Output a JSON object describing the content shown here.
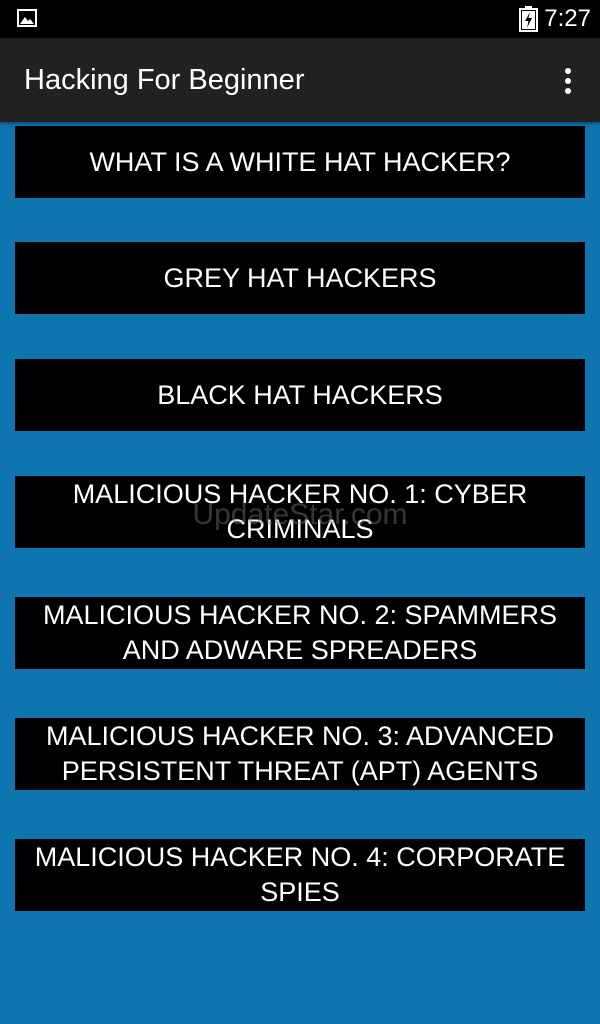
{
  "status_bar": {
    "time": "7:27",
    "icons": [
      "image-icon",
      "battery-charging-icon"
    ]
  },
  "app_bar": {
    "title": "Hacking For Beginner",
    "menu_icon": "overflow-menu-icon"
  },
  "topics": [
    {
      "label": "WHAT IS A WHITE HAT HACKER?"
    },
    {
      "label": "GREY HAT HACKERS"
    },
    {
      "label": "BLACK HAT HACKERS"
    },
    {
      "label": "MALICIOUS HACKER NO. 1: CYBER CRIMINALS"
    },
    {
      "label": "MALICIOUS HACKER NO. 2: SPAMMERS AND ADWARE SPREADERS"
    },
    {
      "label": "MALICIOUS HACKER NO. 3: ADVANCED PERSISTENT THREAT (APT) AGENTS"
    },
    {
      "label": "MALICIOUS HACKER NO. 4: CORPORATE SPIES"
    }
  ],
  "watermark": "UpdateStar.com",
  "colors": {
    "background": "#0f75b0",
    "button": "#000000",
    "app_bar": "#212121",
    "status_bar": "#000000",
    "text": "#ffffff"
  }
}
